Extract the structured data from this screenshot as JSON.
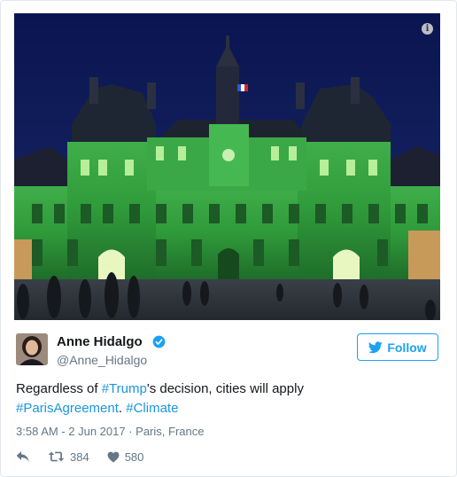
{
  "media": {
    "description_icon": "info-icon",
    "info_glyph": "i"
  },
  "author": {
    "name": "Anne Hidalgo",
    "handle": "@Anne_Hidalgo",
    "verified": true
  },
  "follow_button": {
    "label": "Follow",
    "icon": "twitter-bird-icon",
    "color": "#1da1f2"
  },
  "tweet": {
    "text_1": "Regardless of ",
    "hashtag_trump": "#Trump",
    "text_2": "'s decision, cities will apply",
    "hashtag_paris": "#ParisAgreement",
    "text_3": ". ",
    "hashtag_climate": "#Climate",
    "link_color": "#1b95e0"
  },
  "meta": {
    "timestamp": "3:58 AM - 2 Jun 2017",
    "separator": " · ",
    "location": "Paris, France"
  },
  "actions": {
    "retweets": "384",
    "likes": "580"
  }
}
